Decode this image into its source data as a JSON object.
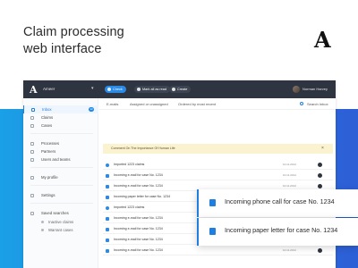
{
  "hero": {
    "title_line1": "Claim processing",
    "title_line2": "web interface",
    "brand_mark": "A"
  },
  "topbar": {
    "logo": "A",
    "app_name": "Ameer",
    "buttons": {
      "check": "Check",
      "mark_all_read": "Mark all as read",
      "create": "Create"
    },
    "user_name": "Norman Harvey"
  },
  "sidebar": {
    "items": [
      {
        "label": "Inbox",
        "count": "12",
        "active": true
      },
      {
        "label": "Claims"
      },
      {
        "label": "Cases"
      },
      {
        "label": "Processes"
      },
      {
        "label": "Partners"
      },
      {
        "label": "Users and teams"
      },
      {
        "label": "My profile"
      },
      {
        "label": "Settings"
      },
      {
        "label": "Saved searches"
      }
    ],
    "saved_searches": [
      {
        "label": "Inactive claims"
      },
      {
        "label": "Warrant cases"
      }
    ]
  },
  "filters": {
    "emails": "E-mails",
    "assigned": "Assigned or unassigned",
    "ordered": "Ordered by most recent",
    "search": "Search Inbox"
  },
  "banner": {
    "text": "Comment On The Importance Of Human Life",
    "close": "×"
  },
  "rows": [
    {
      "title": "Imported 1223 claims",
      "date": "10.11.2014"
    },
    {
      "title": "Incoming e-mail for case No. 1234",
      "date": "10.11.2014"
    },
    {
      "title": "Incoming e-mail for case No. 1234",
      "date": "10.11.2014"
    },
    {
      "title": "Incoming paper letter for case No. 1234",
      "date": "10.11.2014"
    },
    {
      "title": "Imported 1223 claims",
      "date": "10.11.2014"
    },
    {
      "title": "Incoming e-mail for case No. 1234",
      "date": "10.11.2014"
    },
    {
      "title": "Incoming e-mail for case No. 1234",
      "date": "10.11.2014"
    },
    {
      "title": "Incoming e-mail for case No. 1234",
      "date": "10.11.2014"
    },
    {
      "title": "Incoming e-mail for case No. 1234",
      "date": "10.11.2014"
    }
  ],
  "cards": [
    {
      "title": "Incoming phone call for case No. 1234"
    },
    {
      "title": "Incoming paper letter for case No. 1234"
    }
  ],
  "colors": {
    "accent": "#1f7fe0",
    "topbar": "#2e3440",
    "banner": "#fbf3cf"
  }
}
